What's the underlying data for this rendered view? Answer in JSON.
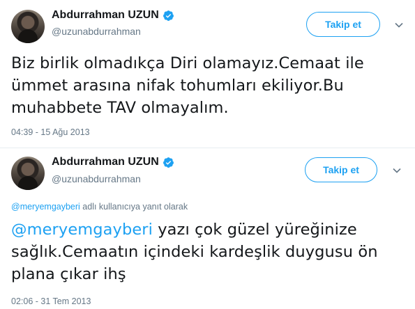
{
  "colors": {
    "accent": "#1da1f2",
    "text": "#14171a",
    "muted": "#657786"
  },
  "tweets": [
    {
      "author": {
        "name": "Abdurrahman UZUN",
        "handle": "@uzunabdurrahman",
        "verified_icon": "verified-badge"
      },
      "follow_label": "Takip et",
      "text_lines": [
        "Biz birlik olmadıkça Diri olamayız.Cemaat ile",
        "ümmet arasına nifak tohumları ekiliyor.Bu",
        "muhabbete TAV olmayalım."
      ],
      "timestamp": "04:39 - 15 Ağu 2013"
    },
    {
      "author": {
        "name": "Abdurrahman UZUN",
        "handle": "@uzunabdurrahman",
        "verified_icon": "verified-badge"
      },
      "follow_label": "Takip et",
      "reply_to": {
        "mention": "@meryemgayberi",
        "suffix": " adlı kullanıcıya yanıt olarak"
      },
      "mention": "@meryemgayberi",
      "text_lines": [
        " yazı çok güzel yüreğinize",
        "sağlık.Cemaatın içindeki kardeşlik duygusu ön",
        "plana çıkar ihş"
      ],
      "timestamp": "02:06 - 31 Tem 2013"
    }
  ]
}
